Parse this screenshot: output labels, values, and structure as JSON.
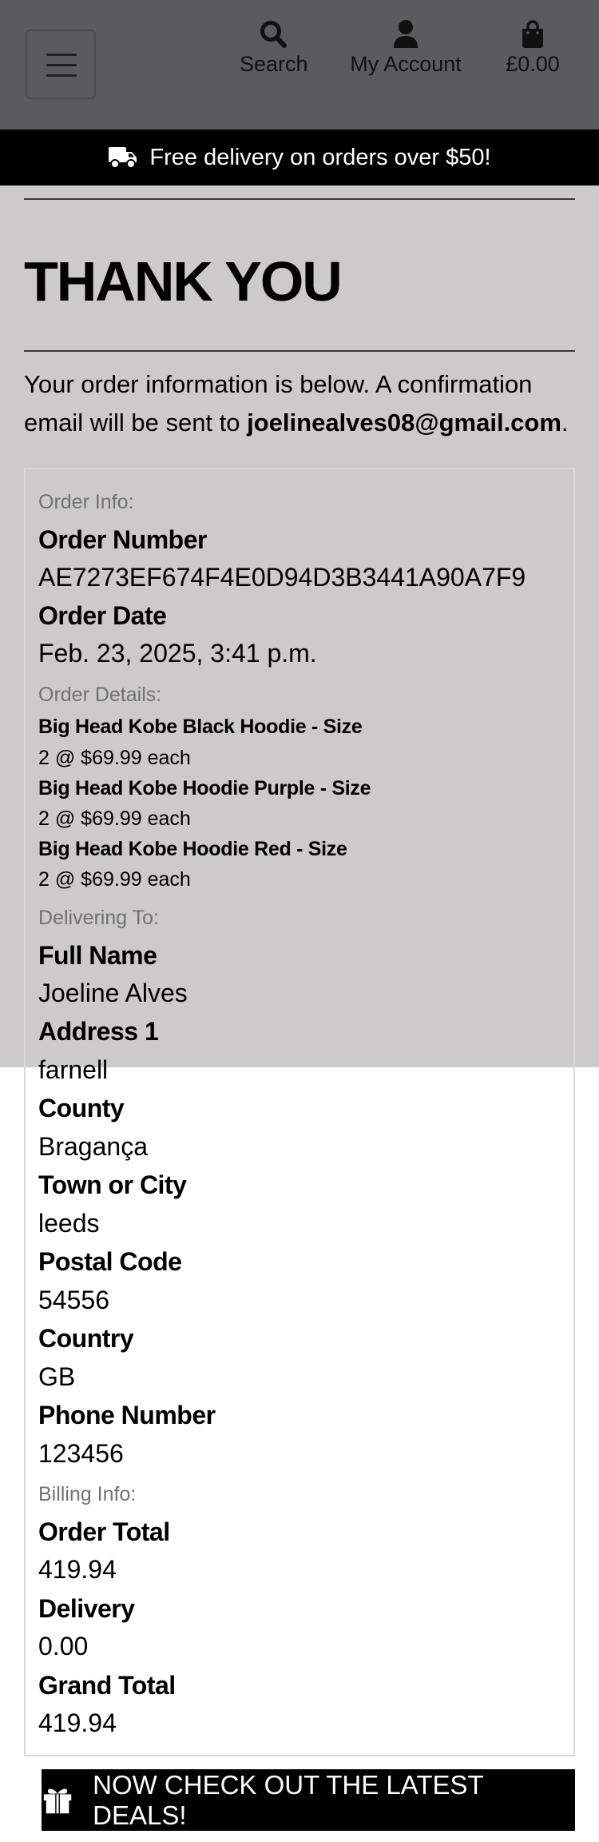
{
  "nav": {
    "search_label": "Search",
    "account_label": "My Account",
    "bag_total": "£0.00"
  },
  "banner": {
    "text": "Free delivery on orders over $50!"
  },
  "page": {
    "title": "THANK YOU",
    "intro_text": "Your order information is below. A confirmation email will be sent to ",
    "email": "joelinealves08@gmail.com",
    "intro_end": "."
  },
  "order_info": {
    "heading": "Order Info:",
    "number_label": "Order Number",
    "number_value": "AE7273EF674F4E0D94D3B3441A90A7F9",
    "date_label": "Order Date",
    "date_value": "Feb. 23, 2025, 3:41 p.m."
  },
  "order_details": {
    "heading": "Order Details:",
    "items": [
      {
        "name": "Big Head Kobe Black Hoodie - Size",
        "qty_price": "2 @ $69.99 each"
      },
      {
        "name": "Big Head Kobe Hoodie Purple - Size",
        "qty_price": "2 @ $69.99 each"
      },
      {
        "name": "Big Head Kobe Hoodie Red - Size",
        "qty_price": "2 @ $69.99 each"
      }
    ]
  },
  "delivering": {
    "heading": "Delivering To:",
    "full_name_label": "Full Name",
    "full_name": "Joeline Alves",
    "address1_label": "Address 1",
    "address1": "farnell",
    "county_label": "County",
    "county": "Bragança",
    "town_label": "Town or City",
    "town": "leeds",
    "postal_label": "Postal Code",
    "postal": "54556",
    "country_label": "Country",
    "country": "GB",
    "phone_label": "Phone Number",
    "phone": "123456"
  },
  "billing": {
    "heading": "Billing Info:",
    "order_total_label": "Order Total",
    "order_total": "419.94",
    "delivery_label": "Delivery",
    "delivery": "0.00",
    "grand_total_label": "Grand Total",
    "grand_total": "419.94"
  },
  "deals_button": {
    "label": "NOW CHECK OUT THE LATEST DEALS!"
  },
  "colors": {
    "navbar": "#595c5d",
    "page_background": "#cdcac9",
    "banner": "#000000",
    "muted_text": "#6d7275"
  },
  "icons": {
    "menu": "hamburger-icon",
    "search": "search-icon",
    "account": "user-icon",
    "bag": "shopping-bag-icon",
    "truck": "truck-icon",
    "gift": "gift-icon"
  }
}
